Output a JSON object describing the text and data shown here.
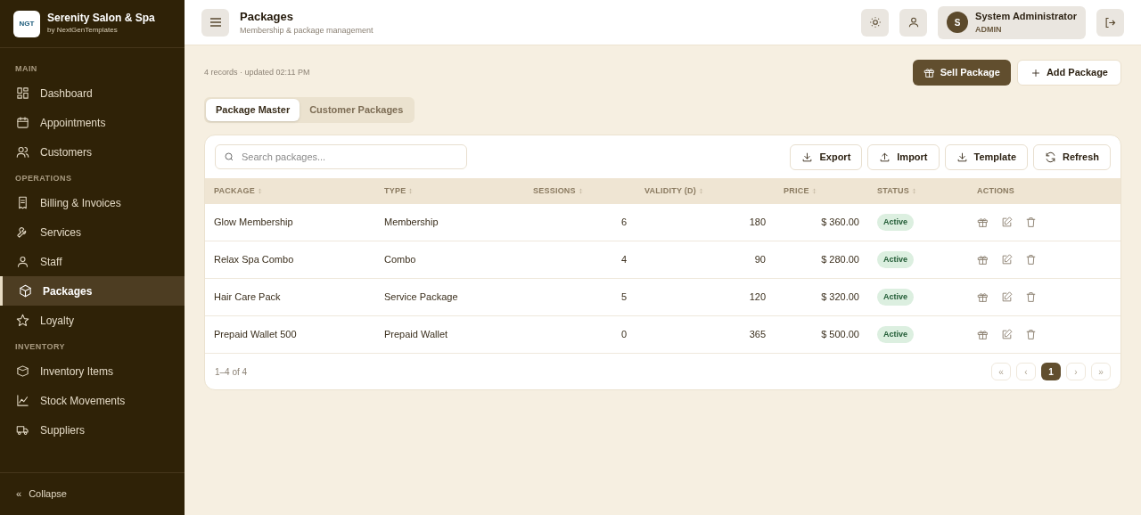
{
  "brand": {
    "logo": "NGT",
    "name": "Serenity Salon & Spa",
    "byline": "by NextGenTemplates"
  },
  "sidebar": {
    "sections": [
      {
        "label": "MAIN",
        "items": [
          {
            "label": "Dashboard",
            "selected": false
          },
          {
            "label": "Appointments",
            "selected": false
          },
          {
            "label": "Customers",
            "selected": false
          }
        ]
      },
      {
        "label": "OPERATIONS",
        "items": [
          {
            "label": "Billing & Invoices",
            "selected": false
          },
          {
            "label": "Services",
            "selected": false
          },
          {
            "label": "Staff",
            "selected": false
          },
          {
            "label": "Packages",
            "selected": true
          },
          {
            "label": "Loyalty",
            "selected": false
          }
        ]
      },
      {
        "label": "INVENTORY",
        "items": [
          {
            "label": "Inventory Items",
            "selected": false
          },
          {
            "label": "Stock Movements",
            "selected": false
          },
          {
            "label": "Suppliers",
            "selected": false
          }
        ]
      }
    ],
    "collapse": {
      "icon": "«",
      "label": "Collapse"
    }
  },
  "header": {
    "title": "Packages",
    "subtitle": "Membership & package management",
    "user": {
      "initial": "S",
      "name": "System Administrator",
      "role": "ADMIN"
    }
  },
  "meta": "4 records · updated 02:11 PM",
  "actions": [
    "Sell Package",
    "Add Package"
  ],
  "tabs": [
    {
      "label": "Package Master",
      "selected": true
    },
    {
      "label": "Customer Packages",
      "selected": false
    }
  ],
  "search": {
    "placeholder": "Search packages..."
  },
  "toolbar": [
    "Export",
    "Import",
    "Template",
    "Refresh"
  ],
  "table": {
    "columns": [
      "PACKAGE",
      "TYPE",
      "SESSIONS",
      "VALIDITY (D)",
      "PRICE",
      "STATUS",
      "ACTIONS"
    ],
    "rows": [
      {
        "package": "Glow Membership",
        "type": "Membership",
        "sessions": "6",
        "validity": "180",
        "price": "$ 360.00",
        "status": "Active"
      },
      {
        "package": "Relax Spa Combo",
        "type": "Combo",
        "sessions": "4",
        "validity": "90",
        "price": "$ 280.00",
        "status": "Active"
      },
      {
        "package": "Hair Care Pack",
        "type": "Service Package",
        "sessions": "5",
        "validity": "120",
        "price": "$ 320.00",
        "status": "Active"
      },
      {
        "package": "Prepaid Wallet 500",
        "type": "Prepaid Wallet",
        "sessions": "0",
        "validity": "365",
        "price": "$ 500.00",
        "status": "Active"
      }
    ]
  },
  "pagination": {
    "summary": "1–4 of 4",
    "buttons": [
      {
        "label": "«",
        "selected": false
      },
      {
        "label": "‹",
        "selected": false
      },
      {
        "label": "1",
        "selected": true
      },
      {
        "label": "›",
        "selected": false
      },
      {
        "label": "»",
        "selected": false
      }
    ]
  }
}
